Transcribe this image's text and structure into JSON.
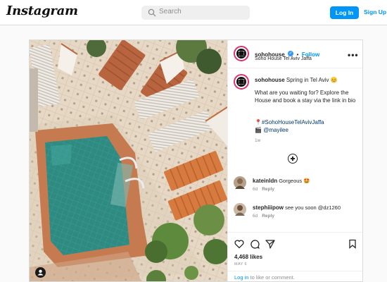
{
  "header": {
    "logo": "Instagram",
    "search_placeholder": "Search",
    "login_label": "Log In",
    "signup_label": "Sign Up"
  },
  "post": {
    "username": "sohohouse",
    "verified_mark": "✓",
    "separator": "•",
    "follow_label": "Follow",
    "location": "Soho House Tel Aviv Jaffa",
    "more_label": "•••",
    "caption": {
      "username": "sohohouse",
      "line1": "Spring in Tel Aviv 😊",
      "body": "What are you waiting for? Explore the House and book a stay via the link in bio",
      "hashtag": "#SohoHouseTelAvivJaffa",
      "pin_emoji": "📍",
      "mention": "@mayilee",
      "clapper_emoji": "🎬",
      "age": "1w"
    },
    "comments": [
      {
        "username": "kateinldn",
        "text": "Gorgeous 🤩",
        "age": "6d",
        "reply": "Reply"
      },
      {
        "username": "stephiiipow",
        "text": "see you soon @dz1260",
        "age": "6d",
        "reply": "Reply"
      }
    ],
    "likes": "4,468 likes",
    "date": "MAY 6",
    "login_link": "Log in",
    "login_suffix": " to like or comment."
  },
  "colors": {
    "accent": "#0095f6",
    "pool_water": "#2e8a80",
    "terracotta": "#c8744a",
    "paving": "#e8dccb"
  },
  "icons": [
    "search-icon",
    "heart-icon",
    "comment-icon",
    "share-icon",
    "bookmark-icon",
    "add-comment-icon",
    "user-tag-icon",
    "more-options-icon"
  ]
}
